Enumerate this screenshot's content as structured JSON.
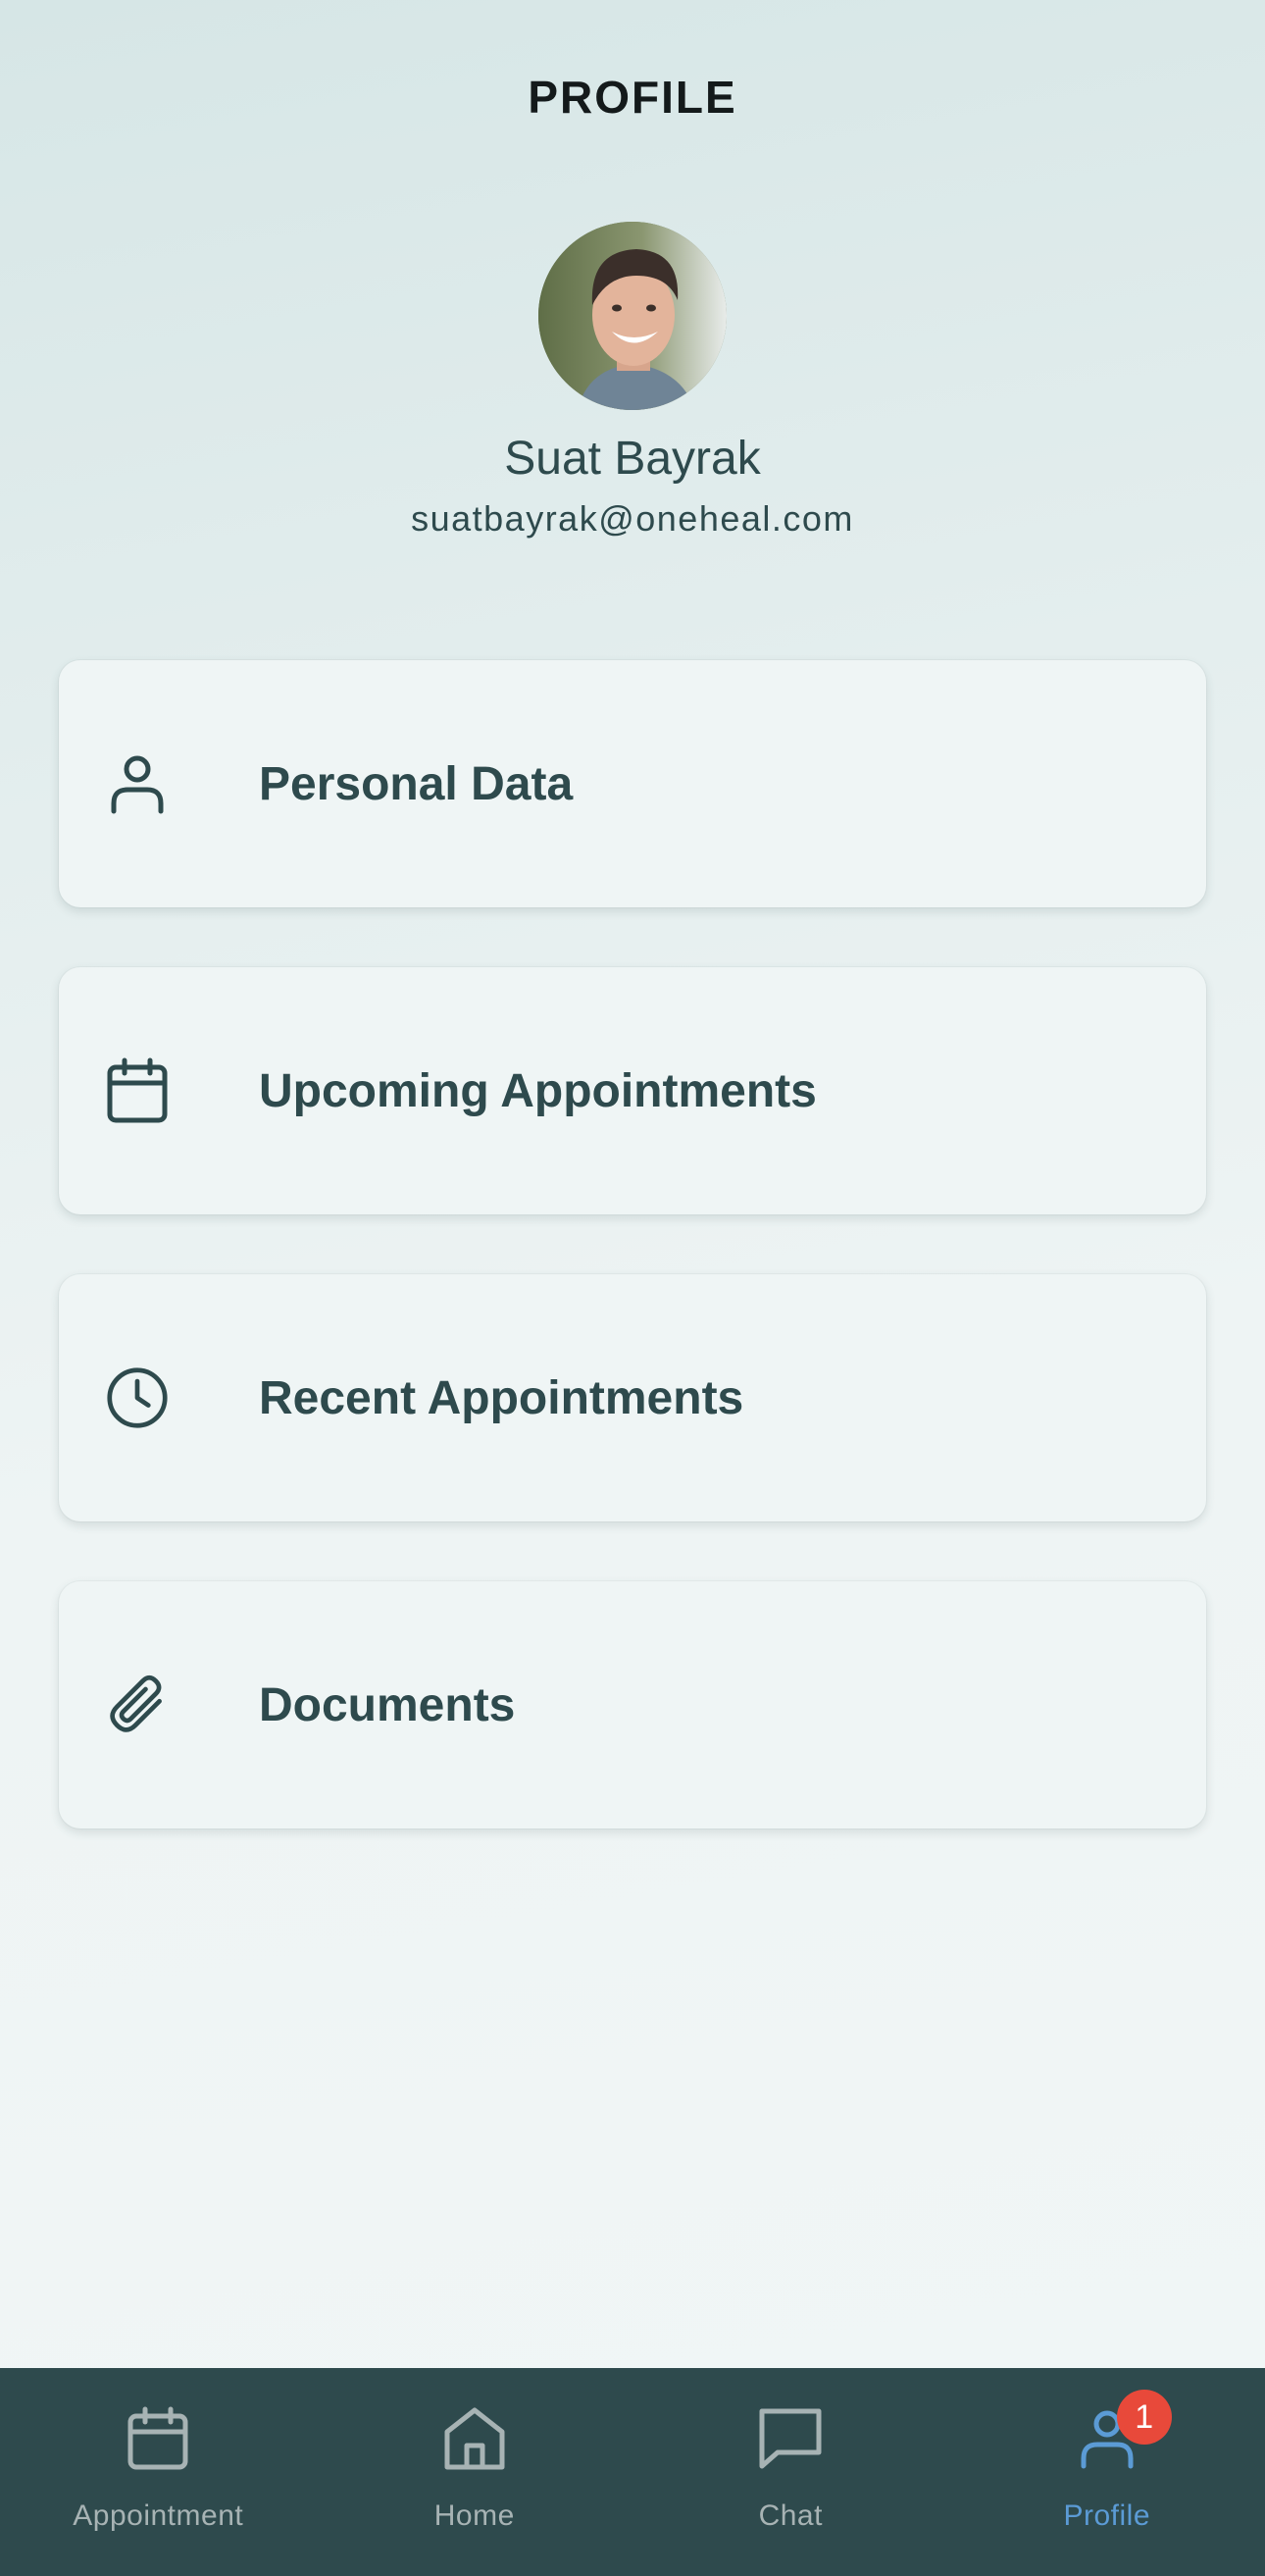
{
  "header": {
    "title": "PROFILE"
  },
  "user": {
    "name": "Suat Bayrak",
    "email": "suatbayrak@oneheal.com"
  },
  "menu": {
    "items": [
      {
        "label": "Personal Data",
        "icon": "person-icon"
      },
      {
        "label": "Upcoming Appointments",
        "icon": "calendar-icon"
      },
      {
        "label": "Recent Appointments",
        "icon": "clock-icon"
      },
      {
        "label": "Documents",
        "icon": "paperclip-icon"
      }
    ]
  },
  "tabbar": {
    "tabs": [
      {
        "label": "Appointment",
        "icon": "calendar-icon",
        "active": false
      },
      {
        "label": "Home",
        "icon": "home-icon",
        "active": false
      },
      {
        "label": "Chat",
        "icon": "chat-bubble-icon",
        "active": false
      },
      {
        "label": "Profile",
        "icon": "person-icon",
        "active": true,
        "badge": "1"
      }
    ]
  },
  "colors": {
    "primary": "#2e4a4d",
    "active_tab": "#5b9bd5",
    "inactive_tab": "#a7b3b4",
    "badge": "#e8493a",
    "card_bg": "#eff5f5"
  }
}
